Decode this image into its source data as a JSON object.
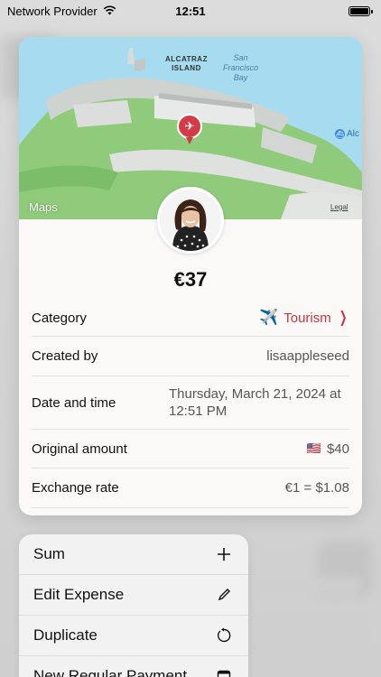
{
  "status_bar": {
    "carrier": "Network Provider",
    "time": "12:51"
  },
  "map": {
    "label_alcatraz_line1": "ALCATRAZ",
    "label_alcatraz_line2": "ISLAND",
    "label_bay_line1": "San",
    "label_bay_line2": "Francisco",
    "label_bay_line3": "Bay",
    "label_alc": "Alc",
    "maps_brand": "Maps",
    "legal": "Legal"
  },
  "expense": {
    "amount": "€37",
    "rows": [
      {
        "label": "Category",
        "value": "Tourism",
        "icon": "airplane-icon"
      },
      {
        "label": "Created by",
        "value": "lisaappleseed"
      },
      {
        "label": "Date and time",
        "value_line1": "Thursday, March 21, 2024 at",
        "value_line2": "12:51 PM"
      },
      {
        "label": "Original amount",
        "value": "$40",
        "flag": "🇺🇸"
      },
      {
        "label": "Exchange rate",
        "value": "€1 = $1.08"
      }
    ]
  },
  "menu": {
    "items": [
      {
        "label": "Sum",
        "icon": "plus-icon"
      },
      {
        "label": "Edit Expense",
        "icon": "pencil-icon"
      },
      {
        "label": "Duplicate",
        "icon": "rotate-icon"
      },
      {
        "label": "New Regular Payment",
        "icon": "calendar-icon"
      }
    ]
  },
  "colors": {
    "accent": "#c8343f",
    "pin": "#d43b48",
    "water": "#9fd7ee",
    "land": "#8fcb7a"
  }
}
